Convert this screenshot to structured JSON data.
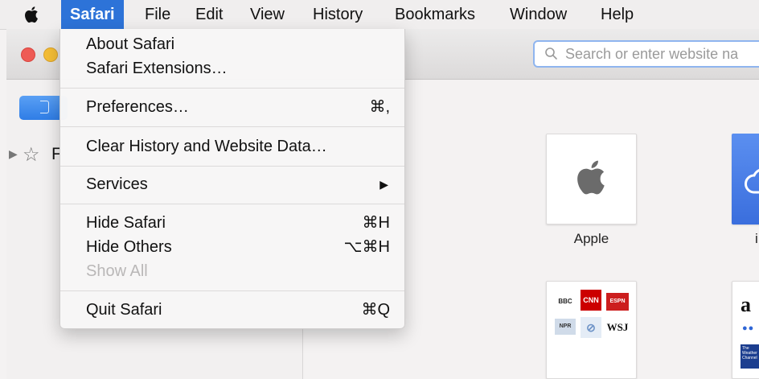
{
  "menubar": {
    "apple": "apple-icon",
    "items": [
      "Safari",
      "File",
      "Edit",
      "View",
      "History",
      "Bookmarks",
      "Window",
      "Help"
    ]
  },
  "toolbar": {
    "search_placeholder": "Search or enter website na"
  },
  "sidebar": {
    "visible_letter": "F"
  },
  "safari_menu": {
    "groups": [
      [
        {
          "label": "About Safari"
        },
        {
          "label": "Safari Extensions…"
        }
      ],
      [
        {
          "label": "Preferences…",
          "shortcut": "⌘,"
        }
      ],
      [
        {
          "label": "Clear History and Website Data…"
        }
      ],
      [
        {
          "label": "Services",
          "submenu": true
        }
      ],
      [
        {
          "label": "Hide Safari",
          "shortcut": "⌘H"
        },
        {
          "label": "Hide Others",
          "shortcut": "⌥⌘H"
        },
        {
          "label": "Show All",
          "disabled": true
        }
      ],
      [
        {
          "label": "Quit Safari",
          "shortcut": "⌘Q"
        }
      ]
    ]
  },
  "top_sites": {
    "tiles": [
      {
        "label": "Apple"
      },
      {
        "label": "i"
      }
    ],
    "news_logos": [
      "BBC",
      "CNN",
      "ESPN",
      "NPR",
      "WSJ"
    ],
    "amazon_letter": "a",
    "weather_text": "The Weather Channel"
  },
  "colors": {
    "menu_highlight": "#2d73d8",
    "url_focus_ring": "#8fb5ef",
    "close_light": "#ee5b55",
    "minimize_light": "#f5be35"
  }
}
